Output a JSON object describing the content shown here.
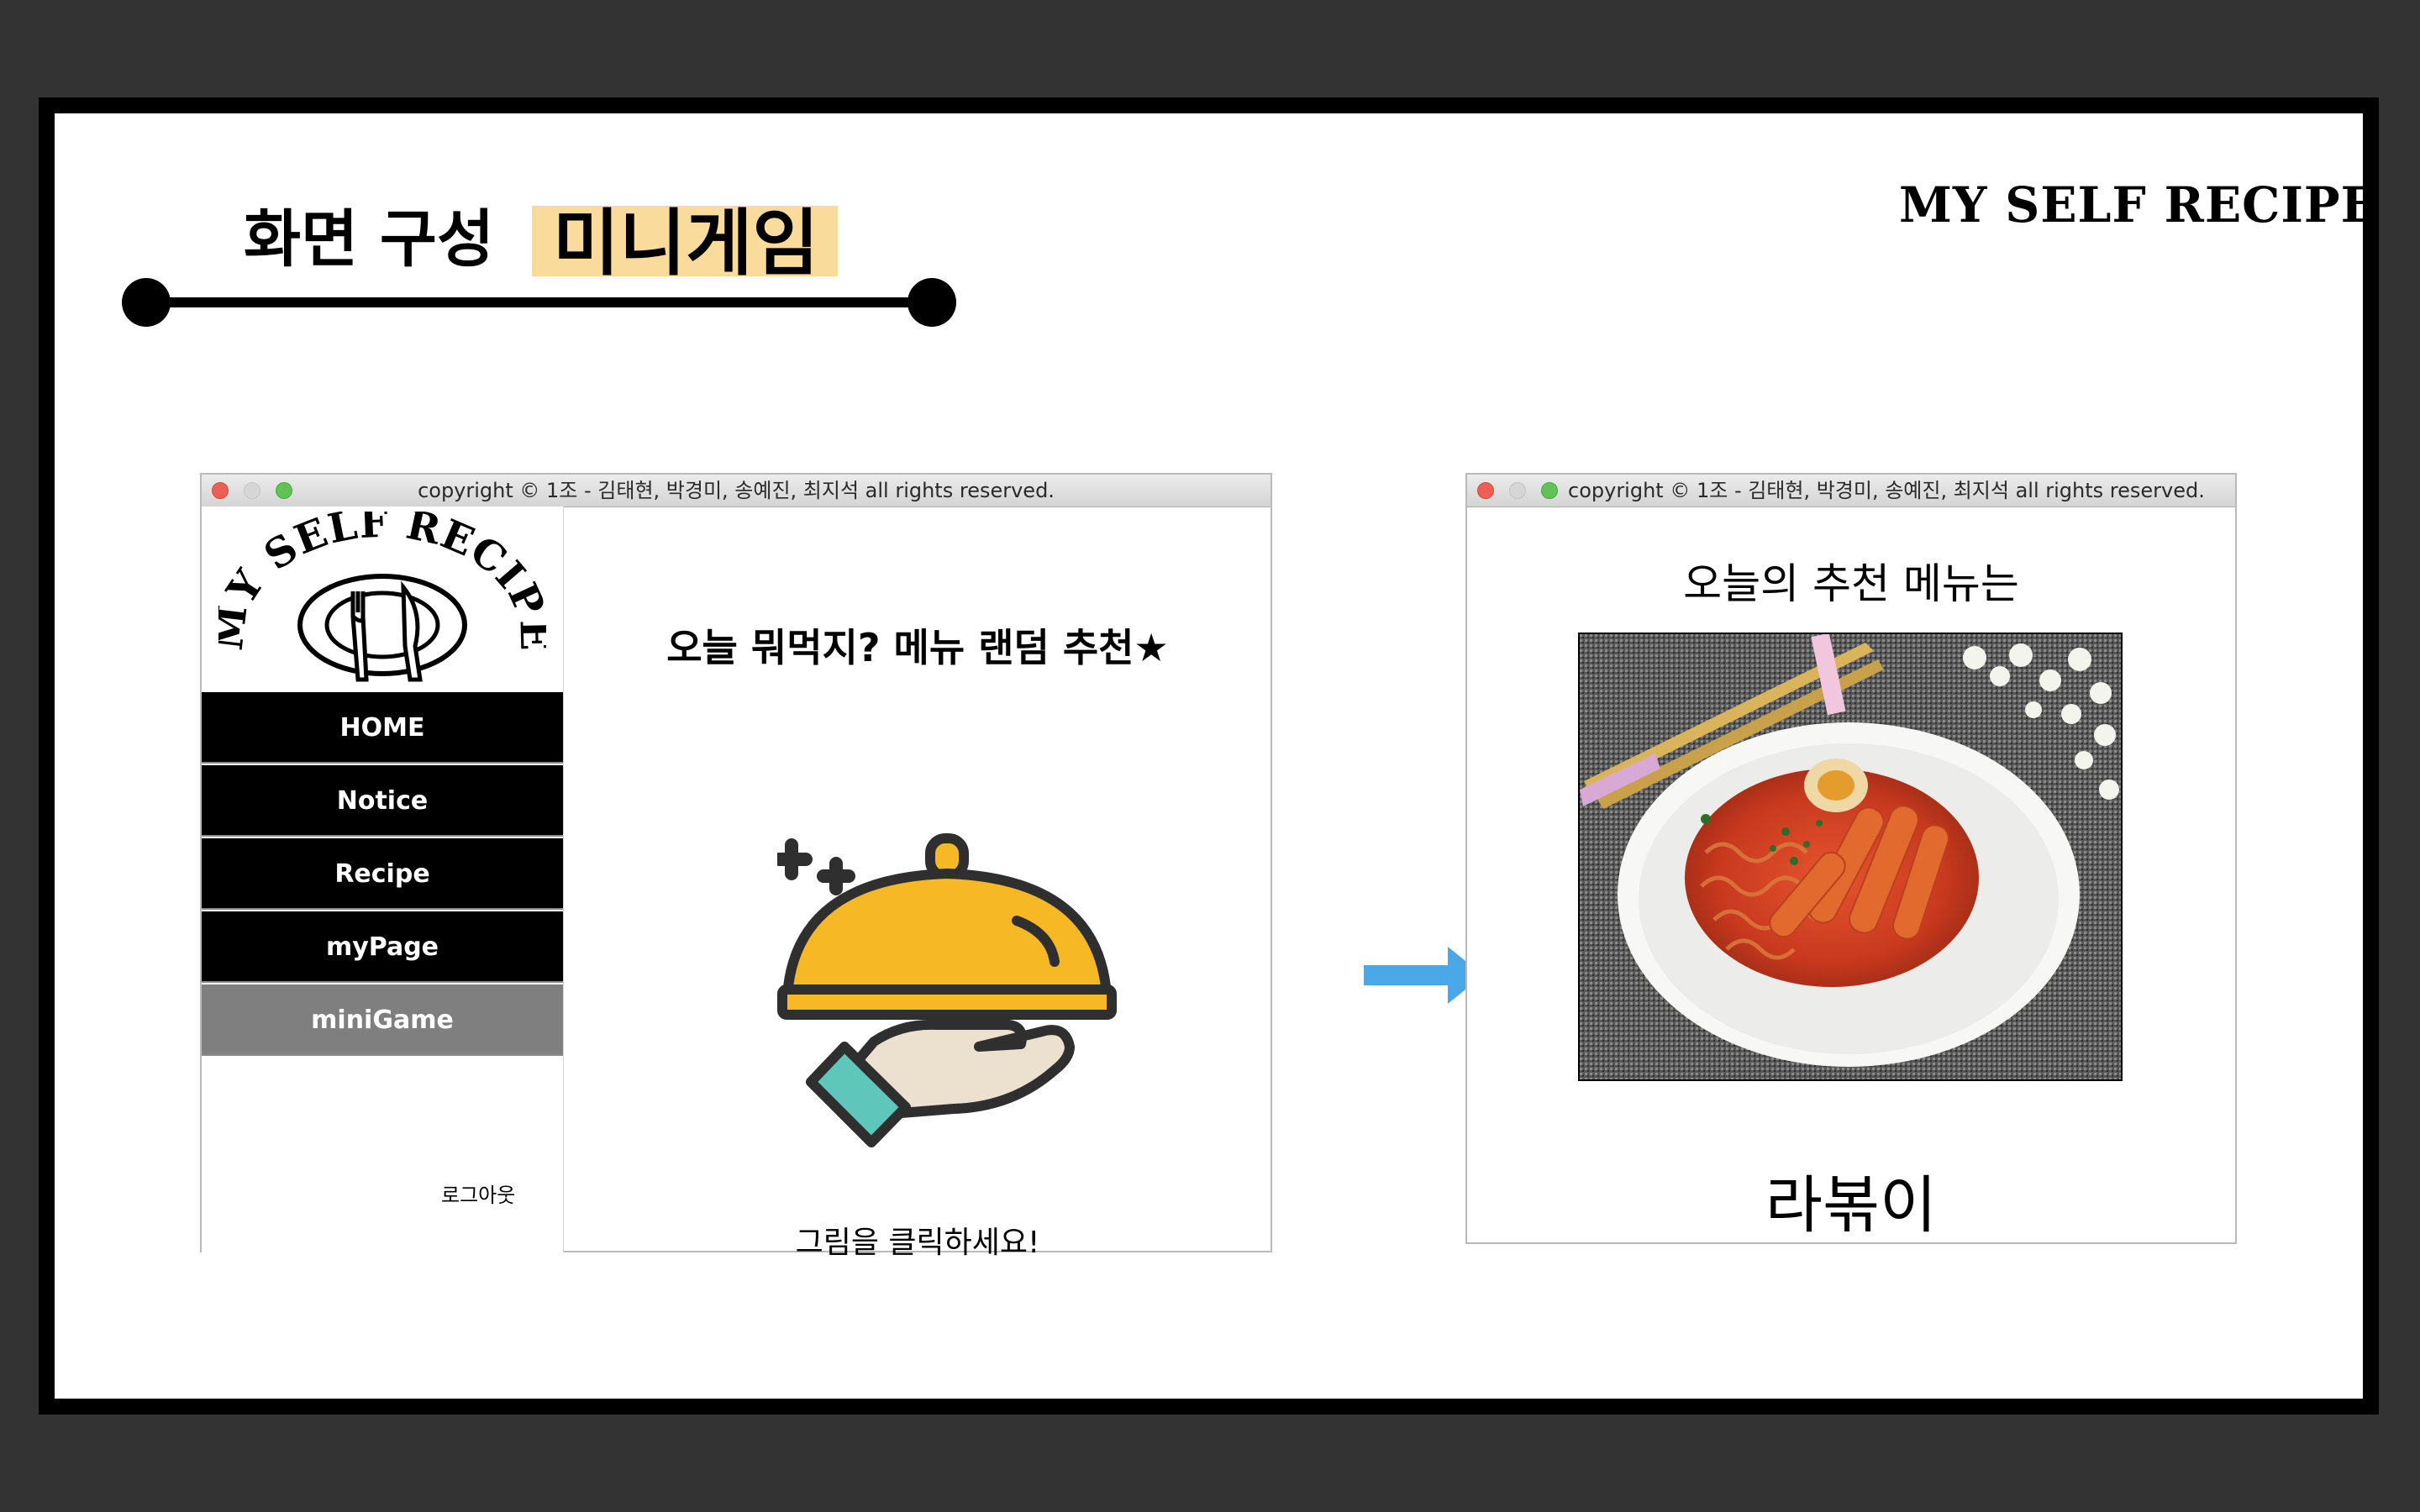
{
  "slide": {
    "brand": "MY SELF RECIPE",
    "heading_prefix": "화면 구성",
    "heading_highlight": "미니게임"
  },
  "left_window": {
    "title": "copyright © 1조 - 김태현, 박경미, 송예진, 최지석 all rights reserved.",
    "logo_text": "MY SELF RECIPE",
    "nav": [
      {
        "label": "HOME"
      },
      {
        "label": "Notice"
      },
      {
        "label": "Recipe"
      },
      {
        "label": "myPage"
      },
      {
        "label": "miniGame",
        "active": true
      }
    ],
    "logout_label": "로그아웃",
    "main_title": "오늘 뭐먹지? 메뉴 랜덤 추천★",
    "click_hint": "그림을 클릭하세요!"
  },
  "right_window": {
    "title": "copyright © 1조 - 김태현, 박경미, 송예진, 최지석 all rights reserved.",
    "recommend_title": "오늘의 추천 메뉴는",
    "menu_name": "라볶이"
  },
  "colors": {
    "highlight": "#f9dc9b",
    "nav_active": "#7f7f7f",
    "arrow": "#4aa8e8",
    "cloche": "#f6b825",
    "cuff": "#5ec6bb"
  },
  "icons": [
    "cloche-icon",
    "arrow-right-icon",
    "fork-knife-plate-icon"
  ]
}
